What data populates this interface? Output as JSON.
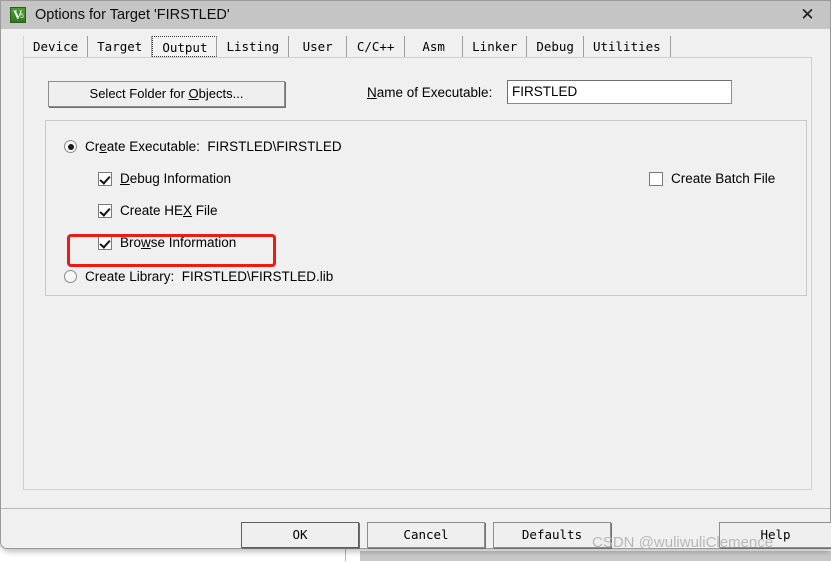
{
  "window": {
    "title": "Options for Target 'FIRSTLED'",
    "icon_name": "keil-uvision-icon",
    "close_glyph": "✕"
  },
  "tabs": [
    {
      "label": "Device",
      "selected": false
    },
    {
      "label": "Target",
      "selected": false
    },
    {
      "label": "Output",
      "selected": true
    },
    {
      "label": "Listing",
      "selected": false
    },
    {
      "label": "User",
      "selected": false
    },
    {
      "label": "C/C++",
      "selected": false
    },
    {
      "label": "Asm",
      "selected": false
    },
    {
      "label": "Linker",
      "selected": false
    },
    {
      "label": "Debug",
      "selected": false
    },
    {
      "label": "Utilities",
      "selected": false
    }
  ],
  "output_page": {
    "select_folder_button": "Select Folder for Objects...",
    "name_of_executable_label": "Name of Executable:",
    "executable_value": "FIRSTLED",
    "executable_placeholder": "",
    "create_executable": {
      "label": "Create Executable:  FIRSTLED\\FIRSTLED",
      "checked": true
    },
    "debug_information": {
      "label": "Debug Information",
      "checked": true
    },
    "create_hex_file": {
      "label": "Create HEX File",
      "checked": true
    },
    "browse_information": {
      "label": "Browse Information",
      "checked": true,
      "highlighted": true,
      "highlight_color": "#ee1b14"
    },
    "create_library": {
      "label": "Create Library:  FIRSTLED\\FIRSTLED.lib",
      "checked": false
    },
    "create_batch_file": {
      "label": "Create Batch File",
      "checked": false
    }
  },
  "footer": {
    "ok": "OK",
    "cancel": "Cancel",
    "defaults": "Defaults",
    "help": "Help"
  },
  "watermark": "CSDN @wuliwuliClemence"
}
